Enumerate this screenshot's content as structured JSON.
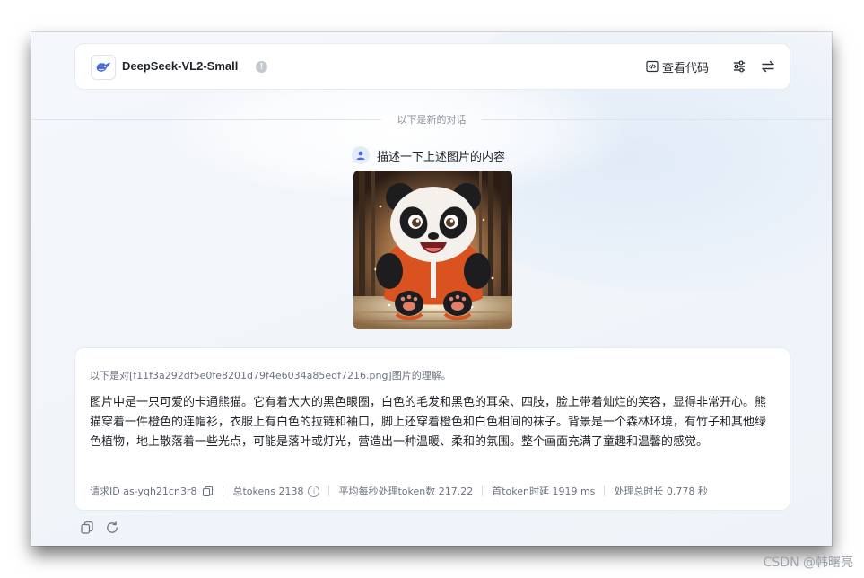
{
  "header": {
    "model_name": "DeepSeek-VL2-Small",
    "info_glyph": "!",
    "view_code_label": "查看代码",
    "icons": [
      "whale-logo-icon",
      "code-window-icon",
      "sliders-icon",
      "swap-arrows-icon"
    ]
  },
  "divider": {
    "label": "以下是新的对话"
  },
  "user_message": {
    "text": "描述一下上述图片的内容",
    "image_alt_icon": "panda-image"
  },
  "reply": {
    "intro": "以下是对[f11f3a292df5e0fe8201d79f4e6034a85edf7216.png]图片的理解。",
    "body": "图片中是一只可爱的卡通熊猫。它有着大大的黑色眼圈，白色的毛发和黑色的耳朵、四肢，脸上带着灿烂的笑容，显得非常开心。熊猫穿着一件橙色的连帽衫，衣服上有白色的拉链和袖口，脚上还穿着橙色和白色相间的袜子。背景是一个森林环境，有竹子和其他绿色植物，地上散落着一些光点，可能是落叶或灯光，营造出一种温暖、柔和的氛围。整个画面充满了童趣和温馨的感觉。",
    "stats": {
      "request_id": "请求ID as-yqh21cn3r8",
      "total_tokens": "总tokens 2138",
      "avg_speed": "平均每秒处理token数 217.22",
      "first_token_latency": "首token时延 1919 ms",
      "total_time": "处理总时长 0.778 秒"
    }
  },
  "actions": [
    "copy-icon",
    "refresh-icon"
  ],
  "watermark": "CSDN @韩曙亮",
  "colors": {
    "accent": "#4b6bd6",
    "text": "#1f2329",
    "muted": "#6b7280",
    "background": "#f1f5fa"
  }
}
